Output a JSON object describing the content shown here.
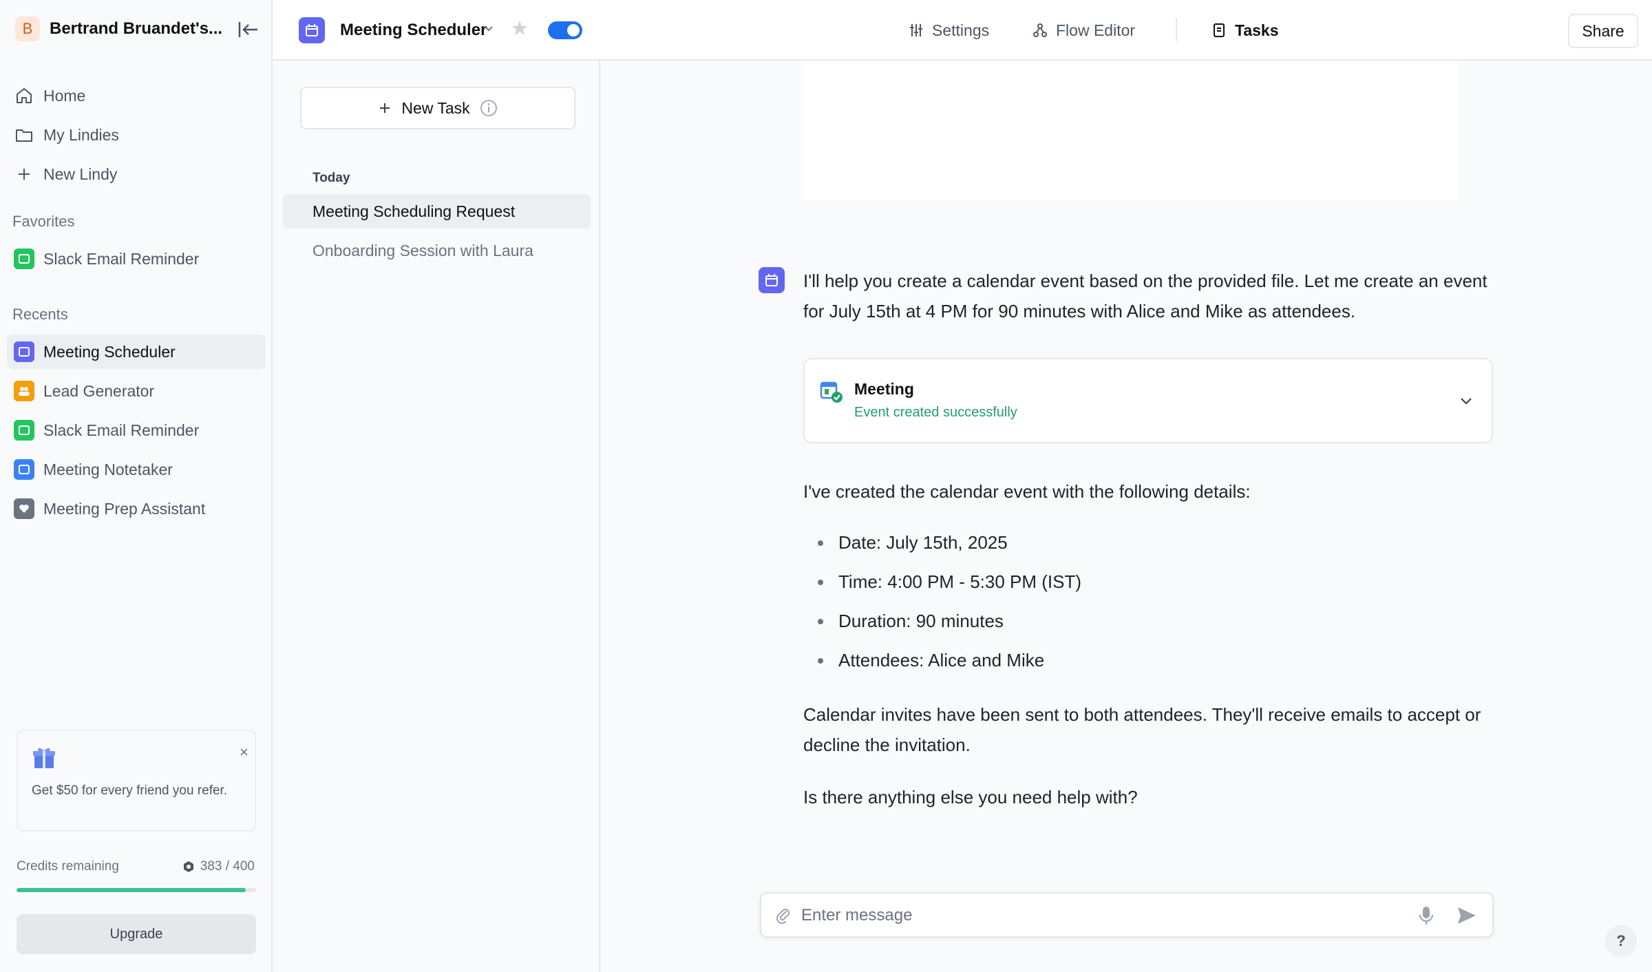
{
  "workspace": {
    "initial": "B",
    "name": "Bertrand Bruandet's..."
  },
  "nav": [
    {
      "label": "Home",
      "icon": "home-icon"
    },
    {
      "label": "My Lindies",
      "icon": "folder-icon"
    },
    {
      "label": "New Lindy",
      "icon": "plus-icon"
    }
  ],
  "favorites": {
    "heading": "Favorites",
    "items": [
      {
        "label": "Slack Email Reminder",
        "icon": "app-icon",
        "color": "#22c55e"
      }
    ]
  },
  "recents": {
    "heading": "Recents",
    "items": [
      {
        "label": "Meeting Scheduler",
        "color": "#6366f1",
        "active": true
      },
      {
        "label": "Lead Generator",
        "color": "#f59e0b"
      },
      {
        "label": "Slack Email Reminder",
        "color": "#22c55e"
      },
      {
        "label": "Meeting Notetaker",
        "color": "#3b82f6"
      },
      {
        "label": "Meeting Prep Assistant",
        "color": "#6b7280"
      }
    ]
  },
  "referral": {
    "text": "Get $50 for every friend you refer.",
    "close": "×",
    "icon": "gift-icon"
  },
  "credits": {
    "label": "Credits remaining",
    "value": "383 / 400",
    "fraction": 0.9575,
    "color": "#34c38f"
  },
  "upgrade_label": "Upgrade",
  "header": {
    "app_title": "Meeting Scheduler",
    "toggle_on": true,
    "tabs": [
      {
        "label": "Settings",
        "icon": "sliders-icon"
      },
      {
        "label": "Flow Editor",
        "icon": "flow-icon"
      },
      {
        "label": "Tasks",
        "icon": "document-icon",
        "active": true
      }
    ],
    "share_label": "Share"
  },
  "tasks_panel": {
    "new_task_label": "New Task",
    "today_heading": "Today",
    "items": [
      {
        "label": "Meeting Scheduling Request",
        "active": true
      },
      {
        "label": "Onboarding Session with Laura"
      }
    ]
  },
  "conversation": {
    "intro": "I'll help you create a calendar event based on the provided file. Let me create an event for July 15th at 4 PM for 90 minutes with Alice and Mike as attendees.",
    "tool_card": {
      "title": "Meeting",
      "status": "Event created successfully"
    },
    "summary_lead": "I've created the calendar event with the following details:",
    "details": [
      "Date: July 15th, 2025",
      "Time: 4:00 PM - 5:30 PM (IST)",
      "Duration: 90 minutes",
      "Attendees: Alice and Mike"
    ],
    "invites_note": "Calendar invites have been sent to both attendees. They'll receive emails to accept or decline the invitation.",
    "closing": "Is there anything else you need help with?"
  },
  "composer": {
    "placeholder": "Enter message"
  },
  "help_label": "?"
}
